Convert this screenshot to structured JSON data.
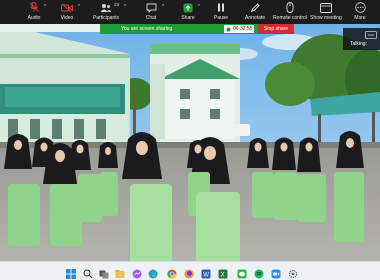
{
  "toolbar": {
    "items": [
      {
        "label": "Audio",
        "icon": "microphone-muted-icon"
      },
      {
        "label": "Video",
        "icon": "video-camera-icon"
      },
      {
        "label": "Participants",
        "icon": "people-icon",
        "count": "23"
      },
      {
        "label": "Chat",
        "icon": "chat-bubble-icon"
      },
      {
        "label": "Share",
        "icon": "share-arrow-icon"
      },
      {
        "label": "Pause",
        "icon": "pause-icon"
      },
      {
        "label": "Annotate",
        "icon": "pencil-icon"
      },
      {
        "label": "Remote control",
        "icon": "mouse-icon"
      },
      {
        "label": "Show meeting",
        "icon": "window-icon"
      },
      {
        "label": "More",
        "icon": "ellipsis-icon"
      }
    ]
  },
  "share_bar": {
    "text": "You are screen sharing",
    "timer": "06:32:55",
    "stop_label": "Stop share"
  },
  "talking": {
    "label": "Talking:"
  },
  "colors": {
    "share_green": "#1f9d38",
    "stop_red": "#d12e2e",
    "toolbar_bg": "#1c1c1e",
    "mute_red": "#e23b3b"
  },
  "taskbar": {
    "icons": [
      "windows-start-icon",
      "search-icon",
      "task-view-icon",
      "file-explorer-icon",
      "messenger-icon",
      "edge-icon",
      "chrome-icon",
      "firefox-icon",
      "word-icon",
      "excel-icon",
      "line-icon",
      "spotify-icon",
      "zoom-icon",
      "settings-icon"
    ]
  }
}
